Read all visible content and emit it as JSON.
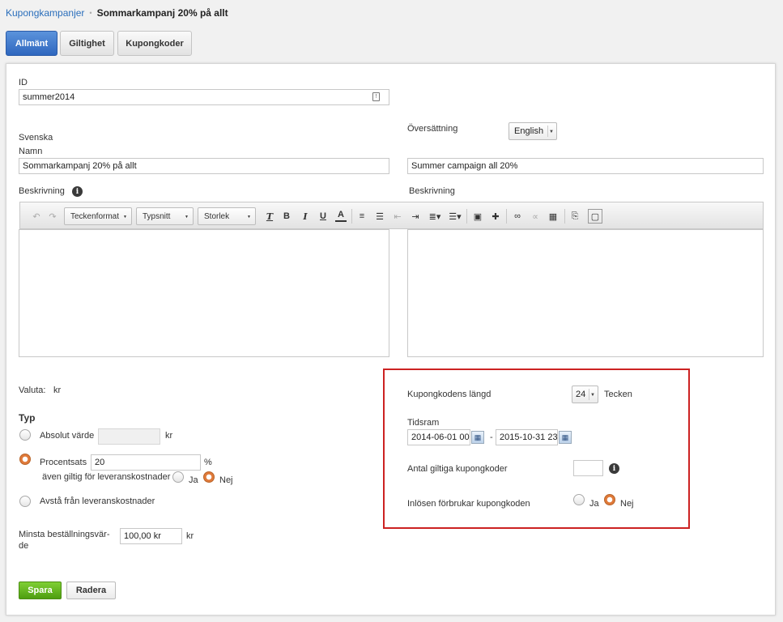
{
  "breadcrumb": {
    "parent": "Kupongkampanjer",
    "current": "Sommarkampanj 20% på allt"
  },
  "tabs": [
    {
      "label": "Allmänt"
    },
    {
      "label": "Giltighet"
    },
    {
      "label": "Kupongkoder"
    }
  ],
  "form": {
    "id_label": "ID",
    "id_value": "summer2014",
    "lang_label": "Svenska",
    "translation_label": "Översättning",
    "translation_select": "English",
    "name_label": "Namn",
    "name_value": "Sommarkampanj 20% på allt",
    "name_translation_value": "Summer campaign all 20%",
    "description_label": "Beskrivning",
    "description_label_right": "Beskrivning",
    "toolbar": {
      "format": "Teckenformat",
      "font": "Typsnitt",
      "size": "Storlek"
    },
    "currency_label": "Valuta:",
    "currency_value": "kr",
    "type_heading": "Typ",
    "absolute_label": "Absolut värde",
    "absolute_unit": "kr",
    "percent_label": "Procentsats",
    "percent_value": "20",
    "percent_unit": "%",
    "shipping_label": "även giltig för leveranskostnader",
    "yes": "Ja",
    "no": "Nej",
    "waive_shipping_label": "Avstå från leveranskostnader",
    "min_order_label": "Minsta beställningsvär-de",
    "min_order_value": "100,00 kr",
    "min_order_unit": "kr",
    "code_length_label": "Kupongkodens längd",
    "code_length_value": "24",
    "code_length_unit": "Tecken",
    "timeframe_label": "Tidsram",
    "date_from": "2014-06-01 00",
    "date_sep": "-",
    "date_to": "2015-10-31 23",
    "valid_codes_label": "Antal giltiga kupongkoder",
    "redeem_label": "Inlösen förbrukar kupongkoden",
    "save_label": "Spara",
    "delete_label": "Radera"
  },
  "colors": {
    "accent": "#2f67bf",
    "highlight_border": "#cc2222",
    "save": "#63b520",
    "radio_on": "#e07a3a"
  }
}
